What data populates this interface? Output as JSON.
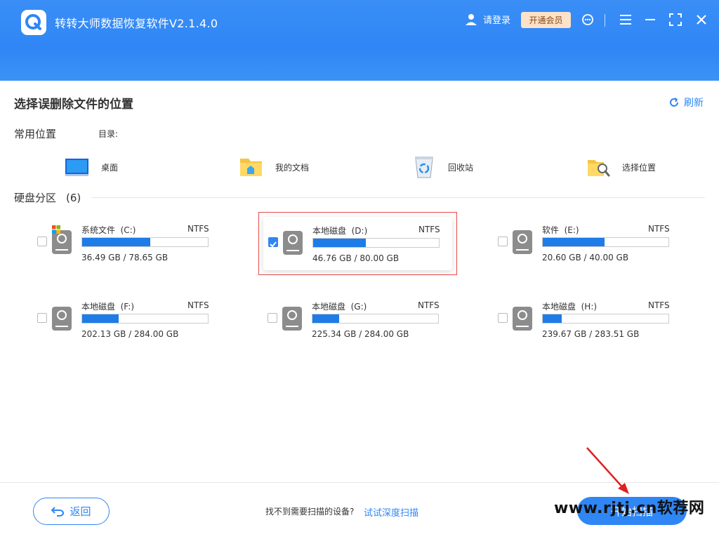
{
  "window": {
    "title": "转转大师数据恢复软件V2.1.4.0",
    "login_label": "请登录",
    "vip_label": "开通会员",
    "icons": [
      "app-logo-icon",
      "user-icon",
      "support-icon",
      "menu-icon",
      "maximize-icon",
      "close-icon"
    ]
  },
  "header": {
    "title": "选择误删除文件的位置",
    "refresh_label": "刷新"
  },
  "common": {
    "label": "常用位置",
    "dir_label": "目录:",
    "items": [
      {
        "label": "桌面",
        "icon": "desktop-icon"
      },
      {
        "label": "我的文档",
        "icon": "documents-folder-icon"
      },
      {
        "label": "回收站",
        "icon": "recycle-bin-icon"
      },
      {
        "label": "选择位置",
        "icon": "browse-folder-icon"
      }
    ]
  },
  "drives": {
    "section_label": "硬盘分区",
    "count": "(6)",
    "items": [
      {
        "name": "系统文件  (C:)",
        "fs": "NTFS",
        "size": "36.49 GB / 78.65 GB",
        "used_fraction": 0.5361,
        "checked": false,
        "system": true
      },
      {
        "name": "本地磁盘  (D:)",
        "fs": "NTFS",
        "size": "46.76 GB / 80.00 GB",
        "used_fraction": 0.4155,
        "checked": true,
        "system": false
      },
      {
        "name": "软件  (E:)",
        "fs": "NTFS",
        "size": "20.60 GB / 40.00 GB",
        "used_fraction": 0.485,
        "checked": false,
        "system": false
      },
      {
        "name": "本地磁盘  (F:)",
        "fs": "NTFS",
        "size": "202.13 GB / 284.00 GB",
        "used_fraction": 0.2883,
        "checked": false,
        "system": false
      },
      {
        "name": "本地磁盘  (G:)",
        "fs": "NTFS",
        "size": "225.34 GB / 284.00 GB",
        "used_fraction": 0.2065,
        "checked": false,
        "system": false
      },
      {
        "name": "本地磁盘  (H:)",
        "fs": "NTFS",
        "size": "239.67 GB / 283.51 GB",
        "used_fraction": 0.1546,
        "checked": false,
        "system": false
      }
    ]
  },
  "footer": {
    "back_label": "返回",
    "not_found_text": "找不到需要扫描的设备?",
    "deep_scan_link": "试试深度扫描",
    "scan_button_label": "开始扫描",
    "watermark": "www.rjtj.cn软荐网"
  },
  "colors": {
    "accent": "#2f86f5",
    "bar_fill": "#1e7ce8",
    "selection_border": "#e84a4a",
    "vip_bg": "#fbe2c8"
  }
}
